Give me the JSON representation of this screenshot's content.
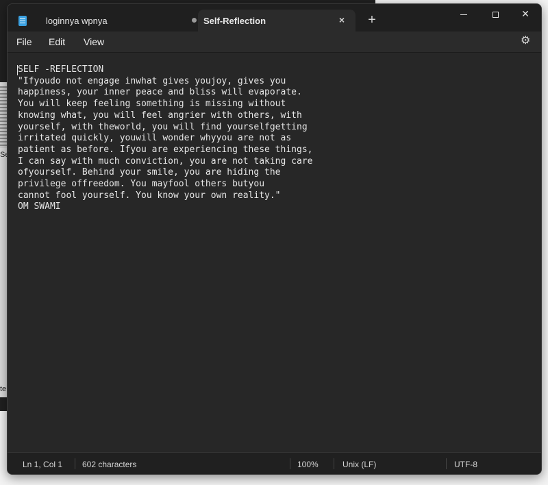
{
  "background": {
    "left_text": "Se",
    "left_text2": "te"
  },
  "tabs": [
    {
      "label": "loginnya wpnya",
      "active": false,
      "modified": true
    },
    {
      "label": "Self-Reflection",
      "active": true
    }
  ],
  "icons": {
    "app": "notepad-icon",
    "close_tab": "×",
    "new_tab": "+",
    "gear": "⚙",
    "close_window": "✕"
  },
  "menu": {
    "file": "File",
    "edit": "Edit",
    "view": "View"
  },
  "document": {
    "text": "SELF -REFLECTION\n\"Ifyoudo not engage inwhat gives youjoy, gives you\nhappiness, your inner peace and bliss will evaporate.\nYou will keep feeling something is missing without\nknowing what, you will feel angrier with others, with\nyourself, with theworld, you will find yourselfgetting\nirritated quickly, youwill wonder whyyou are not as\npatient as before. Ifyou are experiencing these things,\nI can say with much conviction, you are not taking care\nofyourself. Behind your smile, you are hiding the\nprivilege offreedom. You mayfool others butyou\ncannot fool yourself. You know your own reality.\"\nOM SWAMI"
  },
  "status": {
    "position": "Ln 1, Col 1",
    "characters": "602 characters",
    "zoom": "100%",
    "line_ending": "Unix (LF)",
    "encoding": "UTF-8"
  }
}
